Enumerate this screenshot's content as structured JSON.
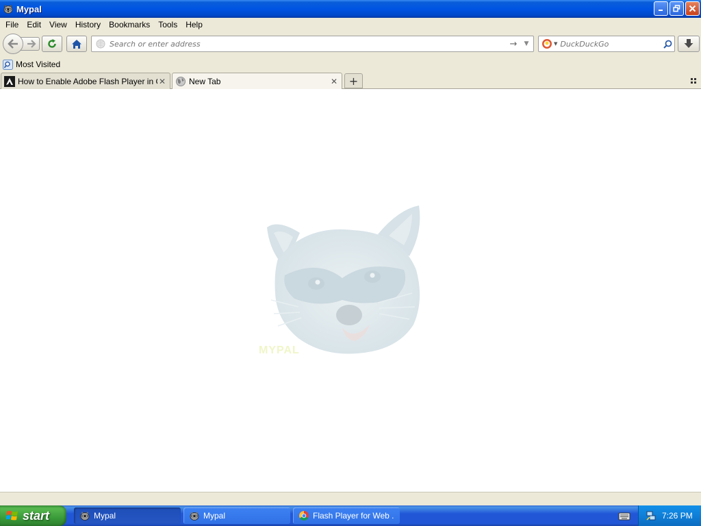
{
  "window": {
    "title": "Mypal"
  },
  "menu": {
    "items": [
      "File",
      "Edit",
      "View",
      "History",
      "Bookmarks",
      "Tools",
      "Help"
    ]
  },
  "urlbar": {
    "placeholder": "Search or enter address",
    "value": ""
  },
  "searchbar": {
    "placeholder": "DuckDuckGo",
    "engine_icon": "duckduckgo-icon"
  },
  "bookmarks": {
    "items": [
      {
        "label": "Most Visited"
      }
    ]
  },
  "tabs": [
    {
      "label": "How to Enable Adobe Flash Player in Goo...",
      "icon": "adobe-icon",
      "active": false
    },
    {
      "label": "New Tab",
      "icon": "globe-icon",
      "active": true
    }
  ],
  "taskbar": {
    "start_label": "start",
    "tasks": [
      {
        "label": "Mypal",
        "icon": "mypal-icon",
        "active": true
      },
      {
        "label": "Mypal",
        "icon": "mypal-icon",
        "active": false
      },
      {
        "label": "Flash Player for Web ...",
        "icon": "chrome-icon",
        "active": false
      }
    ],
    "clock": "7:26 PM"
  },
  "colors": {
    "titlebar": "#0054e3",
    "taskbar": "#2157d7",
    "start": "#3a9b3a",
    "tray": "#0f7fd8"
  }
}
